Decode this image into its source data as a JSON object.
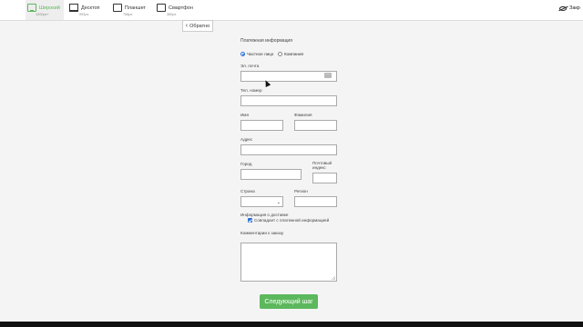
{
  "devices": [
    {
      "label": "Широкий",
      "sub": "1200px+",
      "active": true
    },
    {
      "label": "Десктоп",
      "sub": "992px"
    },
    {
      "label": "Планшет",
      "sub": "768px"
    },
    {
      "label": "Смартфон",
      "sub": "360px"
    }
  ],
  "close_label": "Закр",
  "back_label": "Обратно",
  "form": {
    "section_title": "Платежная информация",
    "payer_options": [
      "Частное лицо",
      "Компания"
    ],
    "email_label": "Эл. почта",
    "phone_label": "Тел. номер",
    "first_name_label": "Имя",
    "last_name_label": "Фамилия",
    "address_label": "Адрес",
    "city_label": "Город",
    "postal_label_1": "Почтовый",
    "postal_label_2": "индекс",
    "country_label": "Страна",
    "region_label": "Регион",
    "shipping_title": "Информация о доставке",
    "same_as_billing": "Совпадает с платежной информацией",
    "comments_label": "Комментарии к заказу",
    "next_button": "Следующий шаг"
  },
  "colors": {
    "accent_green": "#5cb85c",
    "checkbox_blue": "#2a6fd6"
  }
}
